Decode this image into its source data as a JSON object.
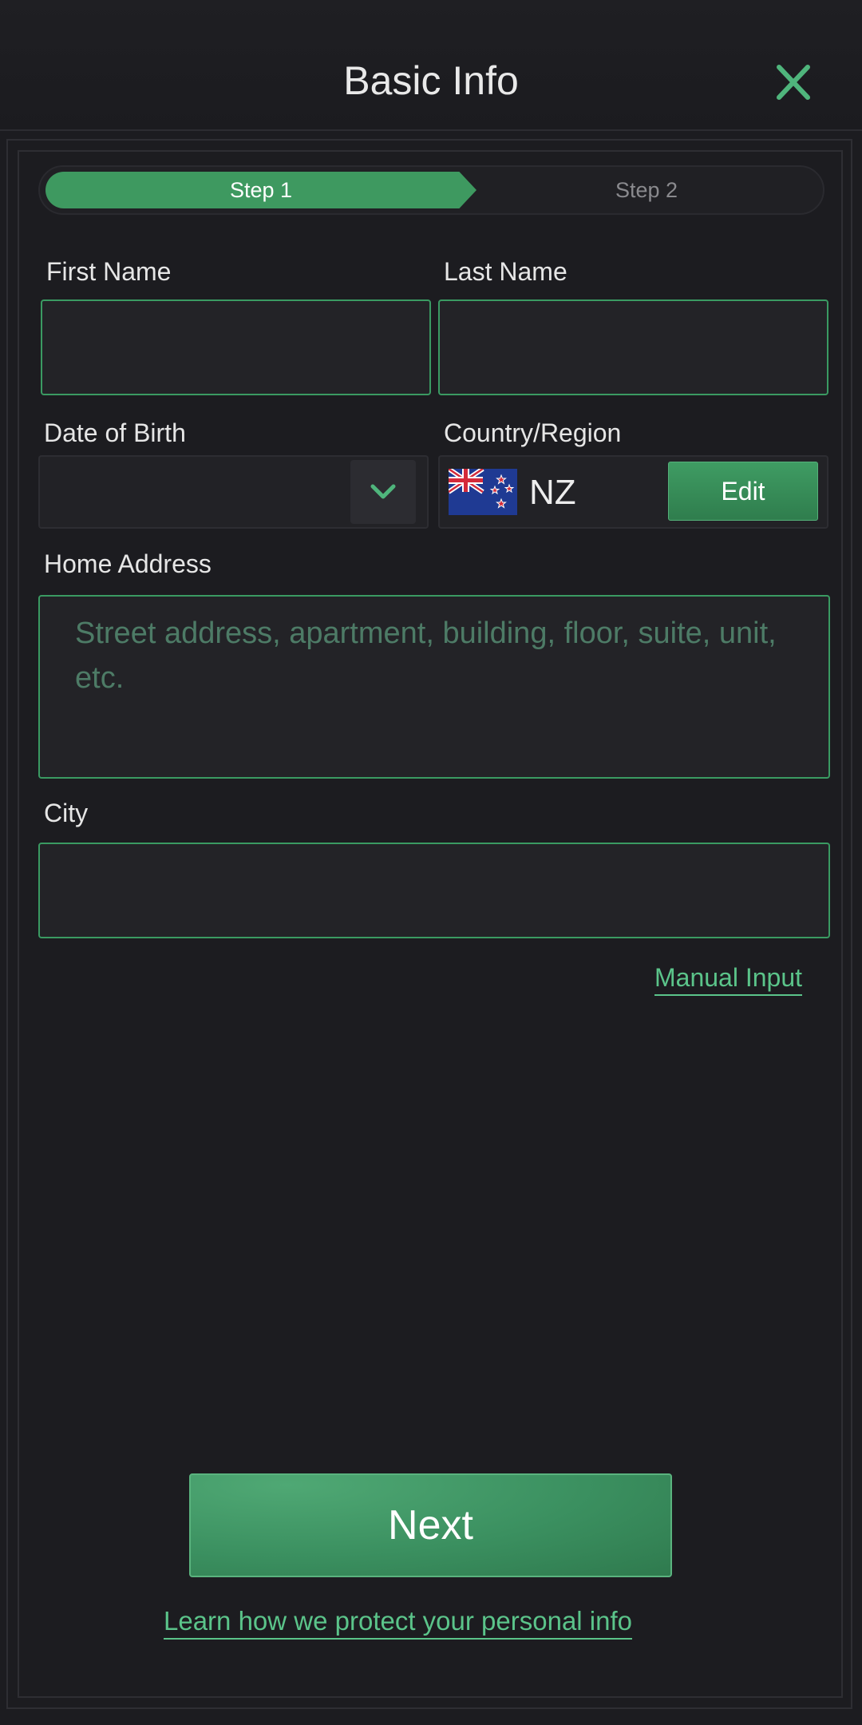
{
  "header": {
    "title": "Basic Info"
  },
  "stepper": {
    "step1": "Step 1",
    "step2": "Step 2",
    "active_step": 1
  },
  "form": {
    "first_name": {
      "label": "First Name",
      "value": ""
    },
    "last_name": {
      "label": "Last Name",
      "value": ""
    },
    "date_of_birth": {
      "label": "Date of Birth",
      "value": ""
    },
    "country": {
      "label": "Country/Region",
      "code": "NZ",
      "edit_label": "Edit",
      "flag_icon": "new-zealand-flag-icon"
    },
    "home_address": {
      "label": "Home Address",
      "placeholder": "Street address, apartment, building, floor, suite, unit, etc.",
      "value": ""
    },
    "city": {
      "label": "City",
      "value": ""
    }
  },
  "links": {
    "manual_input": "Manual Input",
    "privacy": "Learn how we protect your personal info"
  },
  "actions": {
    "next": "Next"
  },
  "colors": {
    "accent": "#3e9960",
    "link": "#5bc48a",
    "background": "#1c1c20"
  }
}
